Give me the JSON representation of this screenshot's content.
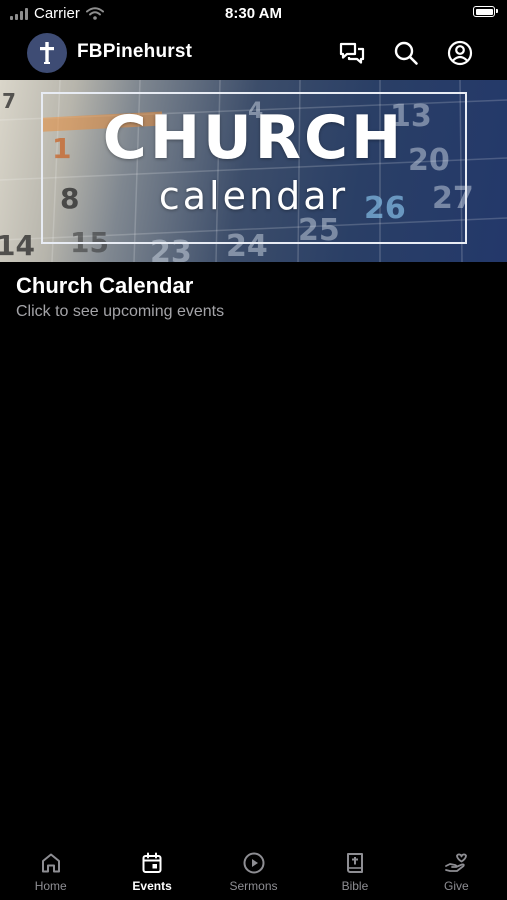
{
  "status_bar": {
    "carrier": "Carrier",
    "time": "8:30 AM"
  },
  "header": {
    "title": "FBPinehurst",
    "icons": [
      "cross-logo-icon",
      "chat-icon",
      "search-icon",
      "profile-icon"
    ]
  },
  "banner": {
    "line1": "CHURCH",
    "line2": "calendar"
  },
  "item": {
    "title": "Church Calendar",
    "subtitle": "Click to see upcoming events"
  },
  "tabs": [
    {
      "label": "Home",
      "icon": "home-icon",
      "active": false
    },
    {
      "label": "Events",
      "icon": "calendar-icon",
      "active": true
    },
    {
      "label": "Sermons",
      "icon": "play-circle-icon",
      "active": false
    },
    {
      "label": "Bible",
      "icon": "bible-icon",
      "active": false
    },
    {
      "label": "Give",
      "icon": "give-heart-hand-icon",
      "active": false
    }
  ],
  "colors": {
    "background": "#000000",
    "avatar": "#3e4c74",
    "subtitle": "#a4a4a8",
    "tab_inactive": "#8e8e93",
    "tab_active": "#ffffff"
  }
}
